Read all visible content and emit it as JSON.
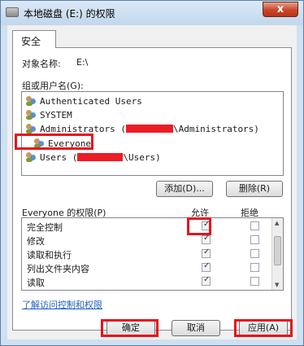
{
  "window": {
    "title": "本地磁盘 (E:) 的权限",
    "close_label": "x"
  },
  "tabs": [
    {
      "label": "安全"
    }
  ],
  "object": {
    "label": "对象名称:",
    "value": "E:\\"
  },
  "groups": {
    "label": "组或用户名(G):",
    "items": [
      {
        "label": "Authenticated Users",
        "icon": "users-group-icon"
      },
      {
        "label": "SYSTEM",
        "icon": "users-group-icon"
      },
      {
        "label": "Administrators (",
        "label_after": "\\Administrators)",
        "icon": "users-group-icon"
      },
      {
        "label": "Everyone",
        "icon": "users-group-icon"
      },
      {
        "label": "Users (",
        "label_after": "\\Users)",
        "icon": "users-group-icon"
      }
    ]
  },
  "buttons": {
    "add": "添加(D)...",
    "remove": "删除(R)",
    "ok": "确定",
    "cancel": "取消",
    "apply": "应用(A)"
  },
  "permissions": {
    "label": "Everyone 的权限(P)",
    "allow_header": "允许",
    "deny_header": "拒绝",
    "rows": [
      {
        "name": "完全控制",
        "allow": true,
        "deny": false
      },
      {
        "name": "修改",
        "allow": true,
        "deny": false
      },
      {
        "name": "读取和执行",
        "allow": true,
        "deny": false
      },
      {
        "name": "列出文件夹内容",
        "allow": true,
        "deny": false
      },
      {
        "name": "读取",
        "allow": true,
        "deny": false
      }
    ]
  },
  "link": "了解访问控制和权限",
  "colors": {
    "highlight": "#e8121b",
    "link": "#2162c1"
  }
}
